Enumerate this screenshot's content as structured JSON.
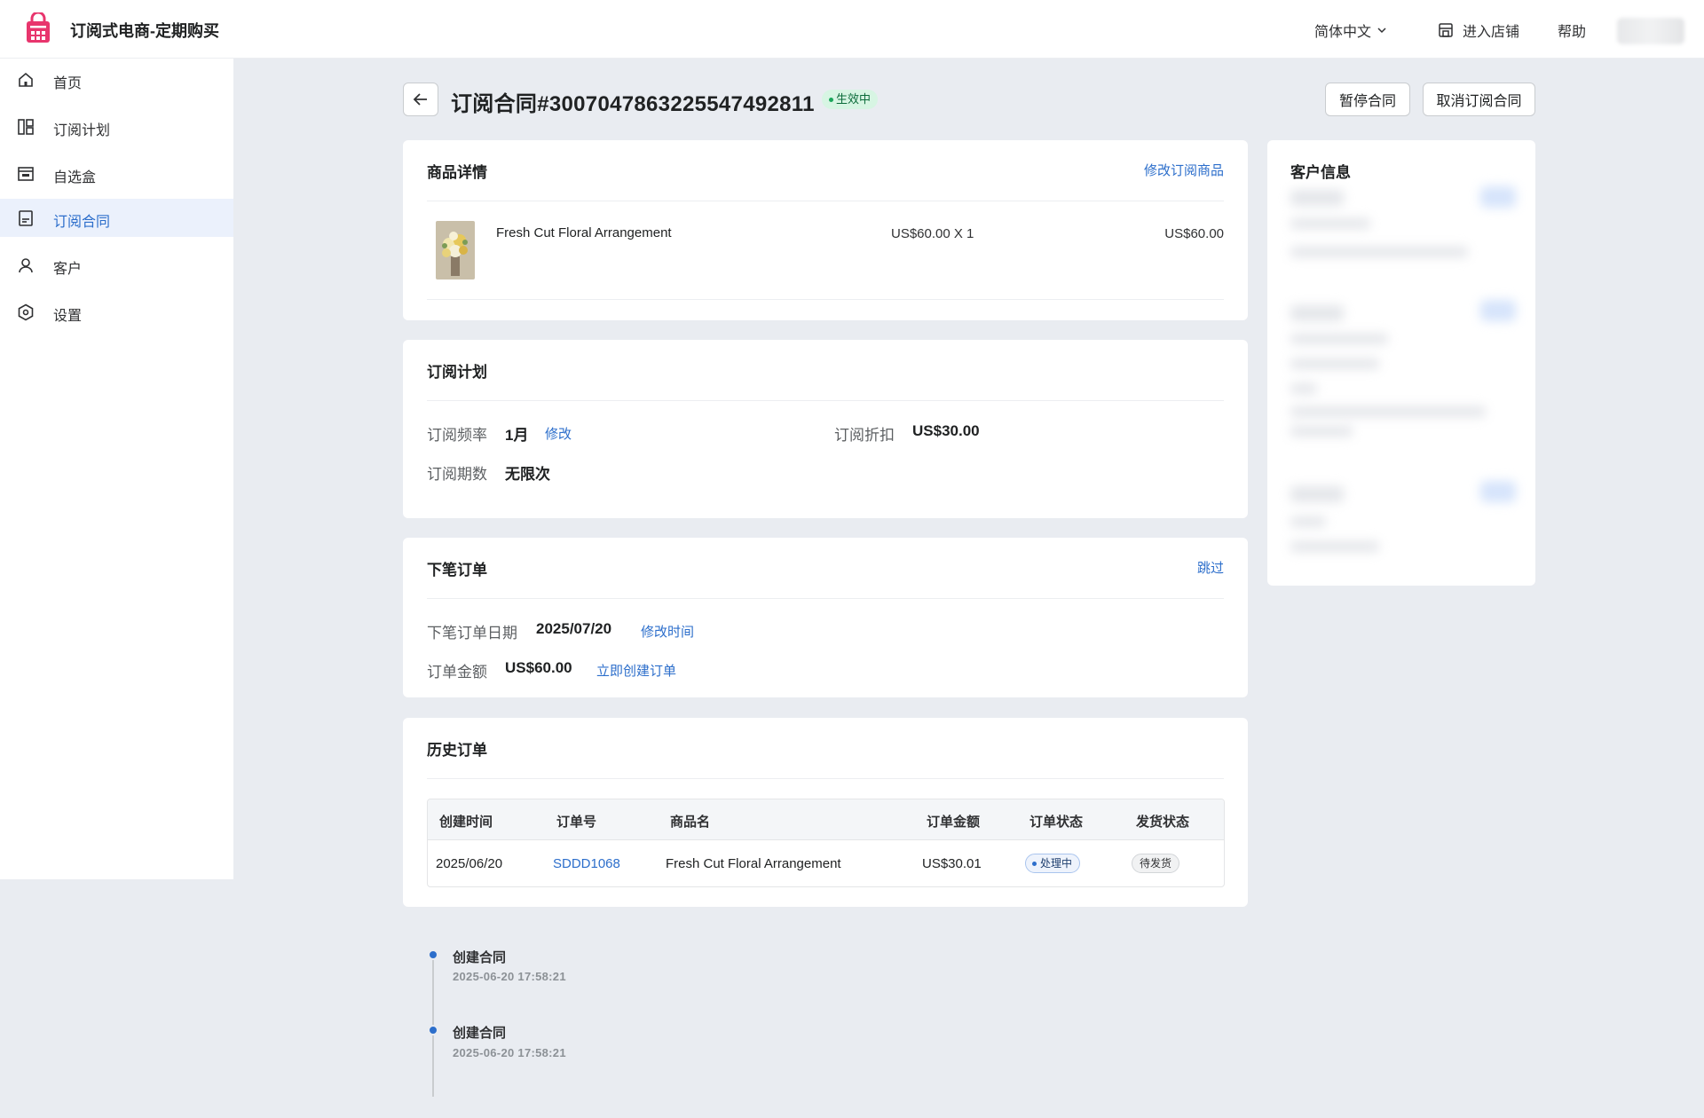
{
  "header": {
    "app_title": "订阅式电商-定期购买",
    "language": "简体中文",
    "store_link": "进入店铺",
    "help": "帮助"
  },
  "sidebar": {
    "items": [
      {
        "label": "首页",
        "icon": "home-icon"
      },
      {
        "label": "订阅计划",
        "icon": "plans-icon"
      },
      {
        "label": "自选盒",
        "icon": "box-icon"
      },
      {
        "label": "订阅合同",
        "icon": "contract-icon",
        "active": true
      },
      {
        "label": "客户",
        "icon": "user-icon"
      },
      {
        "label": "设置",
        "icon": "settings-icon"
      }
    ]
  },
  "page": {
    "title": "订阅合同#3007047863225547492811",
    "status": "生效中",
    "pause_button": "暂停合同",
    "cancel_button": "取消订阅合同"
  },
  "product_card": {
    "title": "商品详情",
    "edit_link": "修改订阅商品",
    "product": {
      "name": "Fresh Cut Floral Arrangement",
      "price_qty": "US$60.00 X 1",
      "total": "US$60.00"
    }
  },
  "plan_card": {
    "title": "订阅计划",
    "frequency_label": "订阅频率",
    "frequency_value": "1月",
    "frequency_edit": "修改",
    "discount_label": "订阅折扣",
    "discount_value": "US$30.00",
    "periods_label": "订阅期数",
    "periods_value": "无限次"
  },
  "next_order_card": {
    "title": "下笔订单",
    "skip_link": "跳过",
    "date_label": "下笔订单日期",
    "date_value": "2025/07/20",
    "date_edit": "修改时间",
    "amount_label": "订单金额",
    "amount_value": "US$60.00",
    "create_now": "立即创建订单"
  },
  "history_card": {
    "title": "历史订单",
    "columns": [
      "创建时间",
      "订单号",
      "商品名",
      "订单金额",
      "订单状态",
      "发货状态"
    ],
    "rows": [
      {
        "created": "2025/06/20",
        "order_no": "SDDD1068",
        "product": "Fresh Cut Floral Arrangement",
        "amount": "US$30.01",
        "order_status": "处理中",
        "ship_status": "待发货"
      }
    ]
  },
  "customer_card": {
    "title": "客户信息"
  },
  "timeline": [
    {
      "title": "创建合同",
      "time": "2025-06-20 17:58:21"
    },
    {
      "title": "创建合同",
      "time": "2025-06-20 17:58:21"
    }
  ],
  "colors": {
    "accent": "#2c6ecb",
    "active_bg": "#ebf1fc",
    "logo": "#e8356d",
    "status_green": "#d7f5e3",
    "page_bg": "#e9ecf1"
  }
}
